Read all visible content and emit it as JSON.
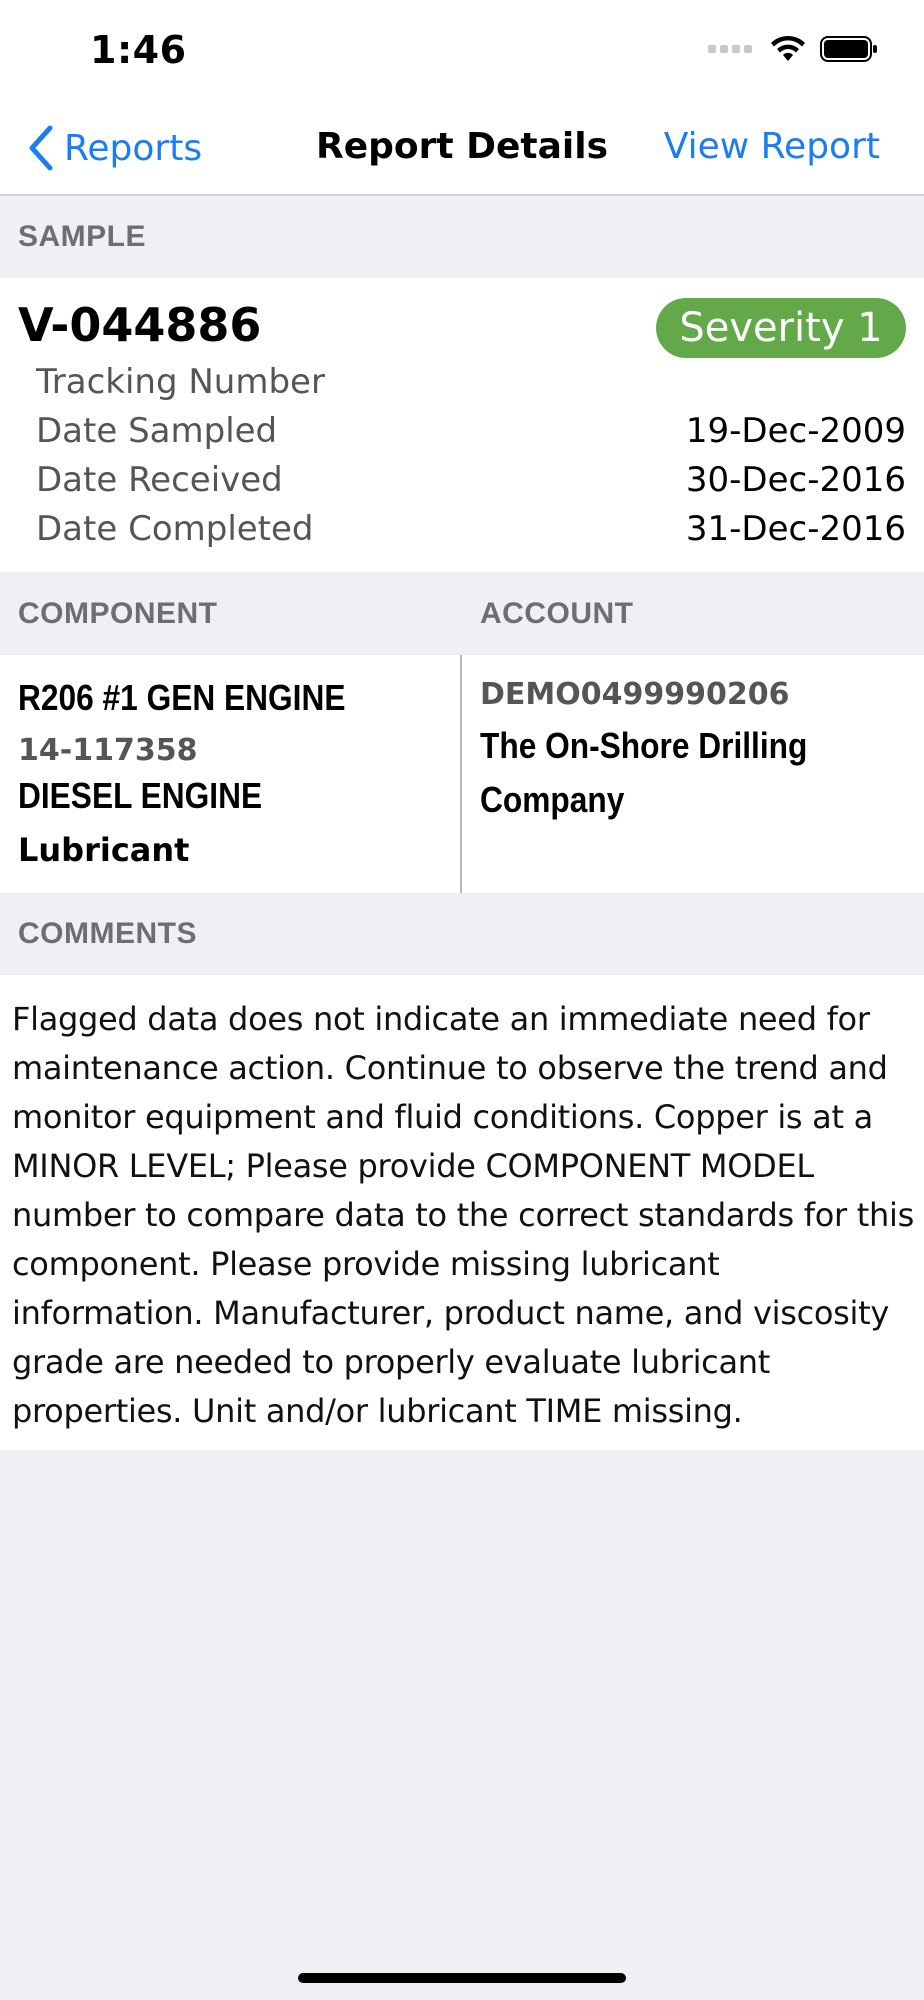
{
  "status_bar": {
    "time": "1:46"
  },
  "nav": {
    "back_label": "Reports",
    "title": "Report Details",
    "right_label": "View Report"
  },
  "sections": {
    "sample": "SAMPLE",
    "component": "COMPONENT",
    "account": "ACCOUNT",
    "comments": "COMMENTS"
  },
  "sample": {
    "id": "V-044886",
    "severity": "Severity 1",
    "severity_color": "#63a94a",
    "rows": [
      {
        "label": "Tracking Number",
        "value": ""
      },
      {
        "label": "Date Sampled",
        "value": "19-Dec-2009"
      },
      {
        "label": "Date Received",
        "value": "30-Dec-2016"
      },
      {
        "label": "Date Completed",
        "value": "31-Dec-2016"
      }
    ]
  },
  "component": {
    "name": "R206 #1 GEN ENGINE",
    "code": "14-117358",
    "type": "DIESEL ENGINE",
    "lubricant": "Lubricant"
  },
  "account": {
    "code": "DEMO0499990206",
    "name": "The On-Shore Drilling Company"
  },
  "comments": {
    "text": "Flagged data does not indicate an immediate need for maintenance action. Continue to observe the trend and monitor equipment and fluid conditions. Copper is at a MINOR LEVEL; Please provide COMPONENT MODEL number to compare data to the correct standards for this component. Please provide missing lubricant information. Manufacturer, product name, and viscosity grade are needed to properly evaluate lubricant properties. Unit and/or lubricant TIME missing."
  },
  "colors": {
    "accent": "#1a7ef2",
    "background": "#efeff4"
  }
}
